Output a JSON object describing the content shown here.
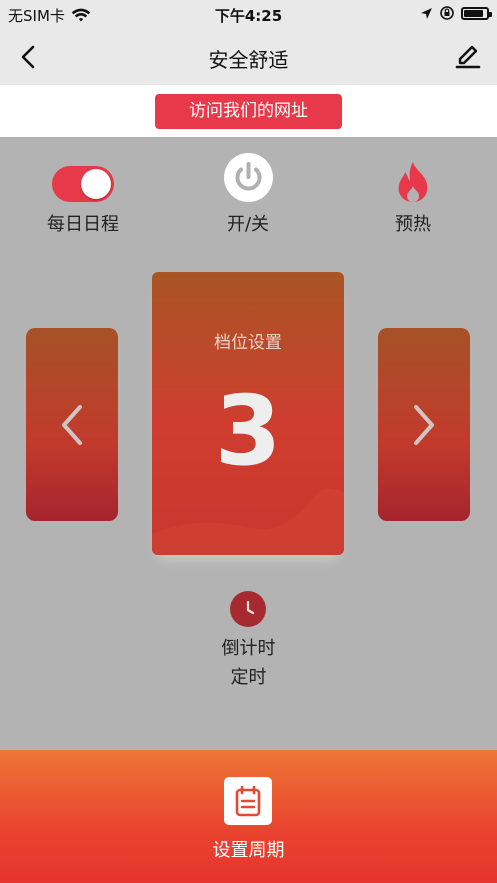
{
  "status_bar": {
    "carrier": "无SIM卡",
    "time": "下午4:25",
    "battery_level": 0.85
  },
  "nav": {
    "title": "安全舒适",
    "back_icon": "chevron-left-icon",
    "edit_icon": "pencil-icon"
  },
  "url_button": "访问我们的网址",
  "controls": {
    "schedule_label": "每日日程",
    "schedule_on": true,
    "power_label": "开/关",
    "preheat_label": "预热"
  },
  "gear": {
    "label": "档位设置",
    "value": "3"
  },
  "countdown": {
    "line1": "倒计时",
    "line2": "定时"
  },
  "bottom": {
    "label": "设置周期"
  },
  "colors": {
    "accent": "#e8394a",
    "card": "#c9362f",
    "bottom_gradient_top": "#ee7636",
    "bottom_gradient_bottom": "#e5352e",
    "background": "#b3b3b3"
  }
}
